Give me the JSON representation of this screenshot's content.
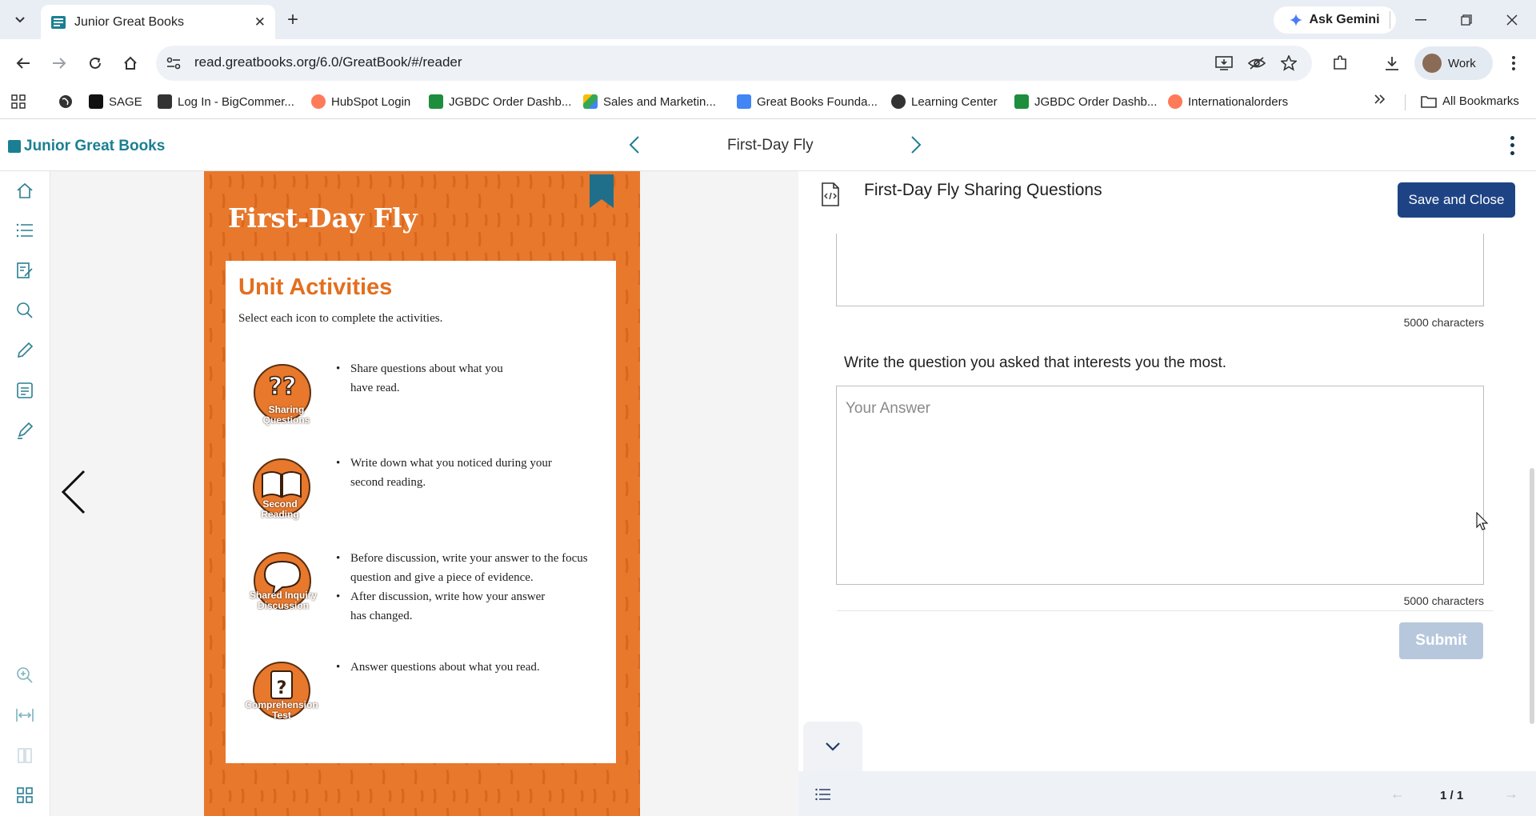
{
  "browser": {
    "tab_title": "Junior Great Books",
    "tab_close": "✕",
    "new_tab": "+",
    "ask_gemini": "Ask Gemini",
    "url": "read.greatbooks.org/6.0/GreatBook/#/reader",
    "profile_label": "Work",
    "bookmarks": [
      {
        "label": "SAGE",
        "color": "#1e8e3e"
      },
      {
        "label": "Log In - BigCommer...",
        "color": "#333333"
      },
      {
        "label": "HubSpot Login",
        "color": "#ff7a59"
      },
      {
        "label": "JGBDC Order Dashb...",
        "color": "#1e8e3e"
      },
      {
        "label": "Sales and Marketin...",
        "color": "#fbbc04"
      },
      {
        "label": "Great Books Founda...",
        "color": "#4285f4"
      },
      {
        "label": "Learning Center",
        "color": "#333333"
      },
      {
        "label": "JGBDC Order Dashb...",
        "color": "#1e8e3e"
      },
      {
        "label": "Internationalorders",
        "color": "#ff7a59"
      }
    ],
    "all_bookmarks": "All Bookmarks"
  },
  "app": {
    "logo_text": "Junior Great Books",
    "book_title": "First-Day Fly",
    "rail_icons": [
      "home-icon",
      "toc-icon",
      "notes-icon",
      "search-icon",
      "pencil-icon",
      "journal-icon",
      "highlighter-icon",
      "zoom-in-icon",
      "fit-width-icon",
      "book-icon",
      "grid-icon"
    ]
  },
  "page": {
    "title": "First-Day Fly",
    "card_title": "Unit Activities",
    "card_subtitle": "Select each icon to complete the activities.",
    "activities": [
      {
        "icon_label": "Sharing Questions",
        "lines": [
          "Share questions about what you",
          "have read."
        ]
      },
      {
        "icon_label": "Second Reading",
        "lines": [
          "Write down what you noticed during your",
          "second reading."
        ]
      },
      {
        "icon_label": "Shared Inquiry Discussion",
        "lines": [
          "Before discussion, write your answer to the focus",
          "question and give a piece of evidence.",
          "After discussion, write how your answer",
          "has changed."
        ]
      },
      {
        "icon_label": "Comprehension Test",
        "lines": [
          "Answer questions about what you read."
        ]
      }
    ]
  },
  "panel": {
    "title": "First-Day Fly Sharing Questions",
    "save_close": "Save and Close",
    "count_1": "5000 characters",
    "question": "Write the question you asked that interests you the most.",
    "answer_placeholder": "Your Answer",
    "count_2": "5000 characters",
    "submit": "Submit",
    "pager": "1 / 1"
  },
  "colors": {
    "accent": "#1e4384",
    "page_orange": "#e8782c",
    "logo_teal": "#1b7f93",
    "heading_orange": "#e36f1f"
  }
}
